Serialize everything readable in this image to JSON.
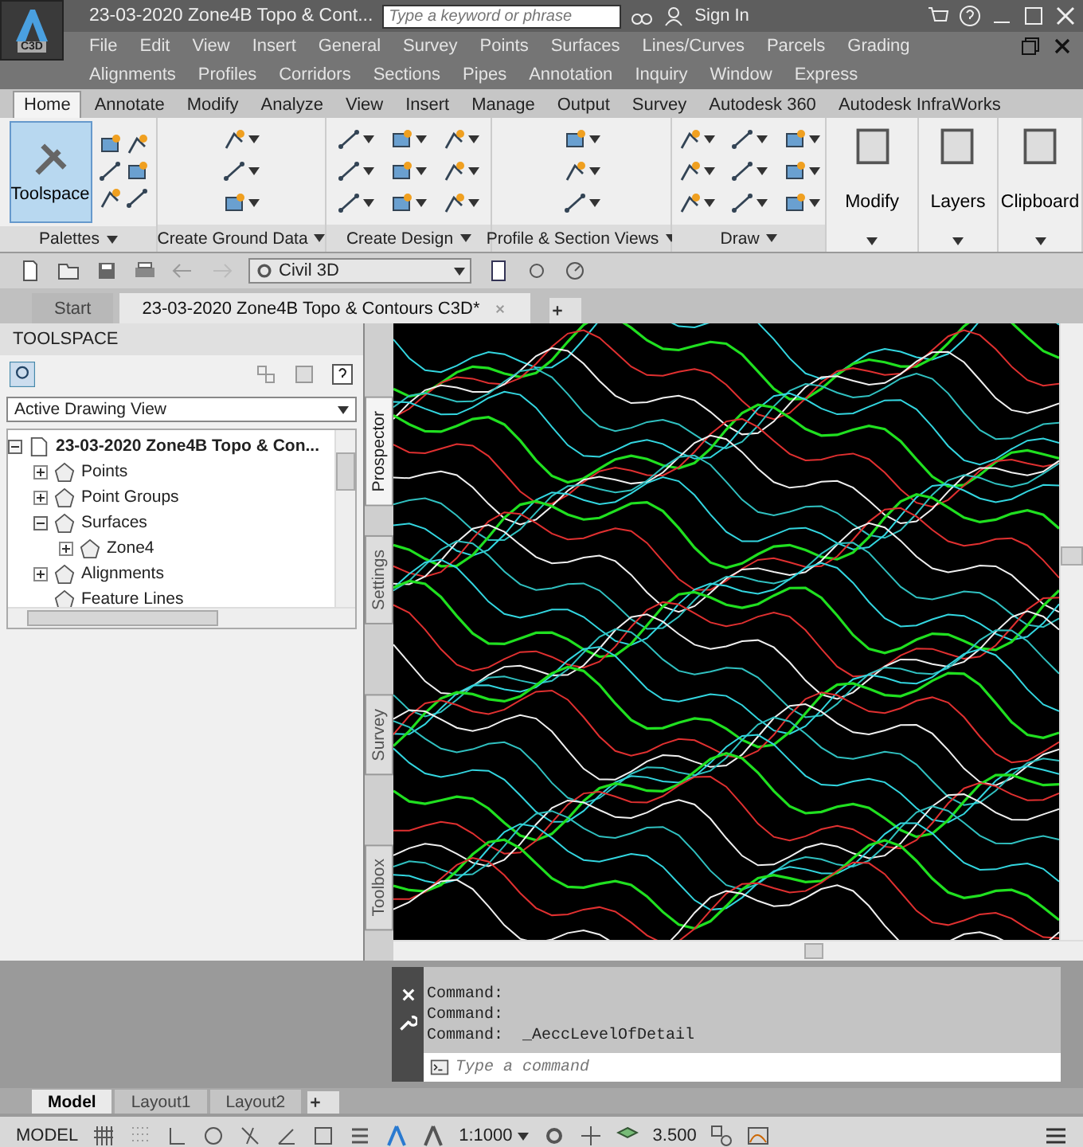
{
  "title_bar": {
    "app_badge": "C3D",
    "title": "23-03-2020 Zone4B Topo & Cont...",
    "search": {
      "placeholder": "Type a keyword or phrase"
    },
    "sign_in": "Sign In"
  },
  "menu_bar": {
    "items": [
      "File",
      "Edit",
      "View",
      "Insert",
      "General",
      "Survey",
      "Points",
      "Surfaces",
      "Lines/Curves",
      "Parcels",
      "Grading",
      "Alignments",
      "Profiles",
      "Corridors",
      "Sections",
      "Pipes",
      "Annotation",
      "Inquiry",
      "Window",
      "Express"
    ]
  },
  "ribbon": {
    "tabs": [
      {
        "label": "Home",
        "selected": true
      },
      {
        "label": "Annotate",
        "selected": false
      },
      {
        "label": "Modify",
        "selected": false
      },
      {
        "label": "Analyze",
        "selected": false
      },
      {
        "label": "View",
        "selected": false
      },
      {
        "label": "Insert",
        "selected": false
      },
      {
        "label": "Manage",
        "selected": false
      },
      {
        "label": "Output",
        "selected": false
      },
      {
        "label": "Survey",
        "selected": false
      },
      {
        "label": "Autodesk 360",
        "selected": false
      },
      {
        "label": "Autodesk InfraWorks",
        "selected": false
      }
    ],
    "panels": [
      {
        "kind": "palettes",
        "title": "Palettes",
        "button": "Toolspace",
        "active": true
      },
      {
        "kind": "column",
        "title": "Create Ground Data"
      },
      {
        "kind": "grid",
        "title": "Create Design"
      },
      {
        "kind": "column",
        "title": "Profile & Section Views"
      },
      {
        "kind": "grid",
        "title": "Draw"
      },
      {
        "kind": "big",
        "title": "Modify"
      },
      {
        "kind": "big",
        "title": "Layers"
      },
      {
        "kind": "big",
        "title": "Clipboard"
      }
    ]
  },
  "quick_access": {
    "workspace": "Civil 3D"
  },
  "file_tabs": [
    {
      "label": "Start",
      "selected": false
    },
    {
      "label": "23-03-2020 Zone4B Topo & Contours C3D*",
      "selected": true
    }
  ],
  "toolspace": {
    "title": "TOOLSPACE",
    "view": "Active Drawing View",
    "tree": {
      "label": "23-03-2020 Zone4B Topo & Con...",
      "expanded": true,
      "has_children": true,
      "children": [
        {
          "label": "Points",
          "expanded": false,
          "has_children": true
        },
        {
          "label": "Point Groups",
          "expanded": false,
          "has_children": true
        },
        {
          "label": "Surfaces",
          "expanded": true,
          "has_children": true,
          "children": [
            {
              "label": "Zone4",
              "expanded": false,
              "has_children": true
            }
          ]
        },
        {
          "label": "Alignments",
          "expanded": false,
          "has_children": true
        },
        {
          "label": "Feature Lines",
          "has_children": false
        }
      ]
    },
    "side_tabs": [
      {
        "label": "Prospector",
        "selected": true
      },
      {
        "label": "Settings",
        "selected": false
      },
      {
        "label": "Survey",
        "selected": false
      },
      {
        "label": "Toolbox",
        "selected": false
      }
    ]
  },
  "command": {
    "history": [
      "Command:",
      "Command:",
      "Command:  _AeccLevelOfDetail"
    ],
    "placeholder": "Type a command"
  },
  "layout_tabs": [
    {
      "label": "Model",
      "selected": true
    },
    {
      "label": "Layout1",
      "selected": false
    },
    {
      "label": "Layout2",
      "selected": false
    }
  ],
  "status_bar": {
    "mode": "MODEL",
    "scale": "1:1000",
    "value": "3.500"
  }
}
